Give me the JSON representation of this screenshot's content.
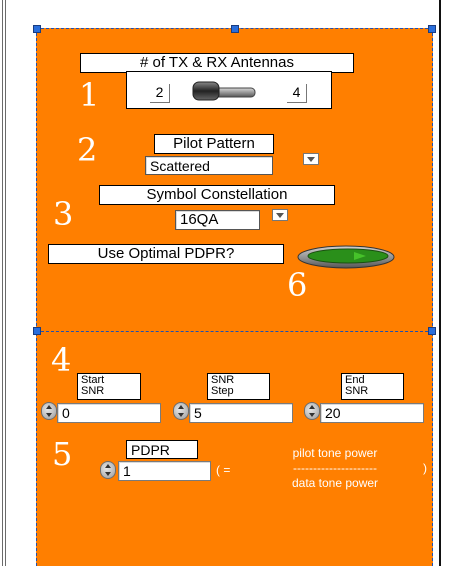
{
  "antennas": {
    "label": "# of TX & RX Antennas",
    "min": "2",
    "max": "4",
    "step_number": "1"
  },
  "pilot": {
    "step_number": "2",
    "label": "Pilot Pattern",
    "value": "Scattered"
  },
  "constellation": {
    "step_number": "3",
    "label": "Symbol Constellation",
    "value": "16QA"
  },
  "optimal_pdpr": {
    "label": "Use Optimal PDPR?",
    "step_number": "6",
    "state": "on"
  },
  "snr": {
    "step_number": "4",
    "start": {
      "label1": "Start",
      "label2": "SNR",
      "value": "0"
    },
    "step": {
      "label1": "SNR",
      "label2": "Step",
      "value": "5"
    },
    "end": {
      "label1": "End",
      "label2": "SNR",
      "value": "20"
    }
  },
  "pdpr": {
    "step_number": "5",
    "label": "PDPR",
    "value": "1",
    "eq_open": "( =",
    "eq_close": ")",
    "numerator": "pilot tone power",
    "divider": "---------------------",
    "denominator": "data tone power"
  },
  "colors": {
    "panel": "#ff7f00",
    "led": "#2a8f1a"
  }
}
